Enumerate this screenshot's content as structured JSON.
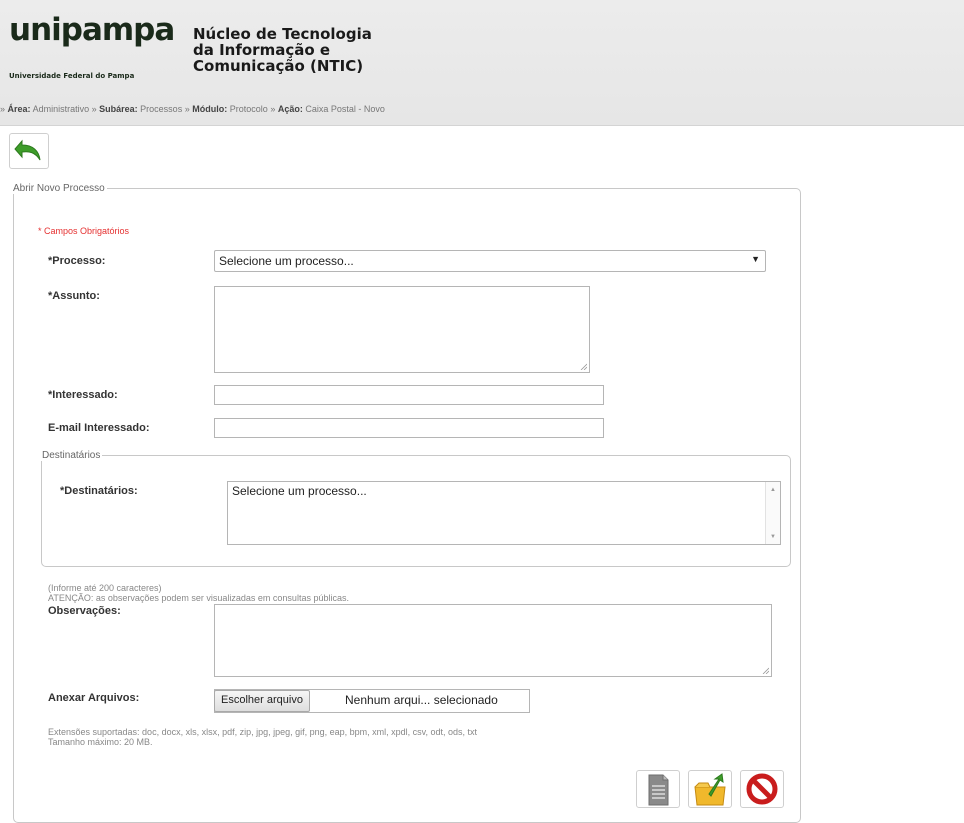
{
  "header": {
    "logo_text": "unipampa",
    "logo_subtitle": "Universidade Federal do Pampa",
    "title_lines": [
      "Núcleo de Tecnologia",
      "da Informação e",
      "Comunicação (NTIC)"
    ]
  },
  "breadcrumb": {
    "prefix": "»",
    "area_label": "Área:",
    "area_value": "Administrativo",
    "subarea_label": "Subárea:",
    "subarea_value": "Processos",
    "modulo_label": "Módulo:",
    "modulo_value": "Protocolo",
    "acao_label": "Ação:",
    "acao_value": "Caixa Postal - Novo",
    "separator": "»"
  },
  "toolbar": {
    "back_icon": "undo-arrow-icon"
  },
  "form": {
    "legend": "Abrir Novo Processo",
    "required_note": "* Campos Obrigatórios",
    "processo_label": "*Processo:",
    "processo_selected": "Selecione um processo...",
    "assunto_label": "*Assunto:",
    "assunto_value": "",
    "interessado_label": "*Interessado:",
    "interessado_value": "",
    "email_label": "E-mail Interessado:",
    "email_value": "",
    "destinatarios_legend": "Destinatários",
    "destinatarios_label": "*Destinatários:",
    "destinatarios_option": "Selecione um processo...",
    "obs_hint": "(Informe até 200 caracteres)",
    "obs_warning": "ATENÇÃO: as observações podem ser visualizadas em consultas públicas.",
    "obs_label": "Observações:",
    "obs_value": "",
    "anexar_label": "Anexar Arquivos:",
    "file_button": "Escolher arquivo",
    "file_status": "Nenhum arqui... selecionado",
    "ext_note": "Extensões suportadas: doc, docx, xls, xlsx, pdf, zip, jpg, jpeg, gif, png, eap, bpm, xml, xpdl, csv, odt, ods, txt",
    "size_note": "Tamanho máximo: 20 MB."
  },
  "actions": {
    "icons": [
      "document-icon",
      "folder-send-icon",
      "cancel-icon"
    ]
  },
  "colors": {
    "required": "#e53030",
    "back_arrow": "#3e9d2a",
    "cancel": "#c91d1d",
    "folder": "#f0b82c"
  }
}
